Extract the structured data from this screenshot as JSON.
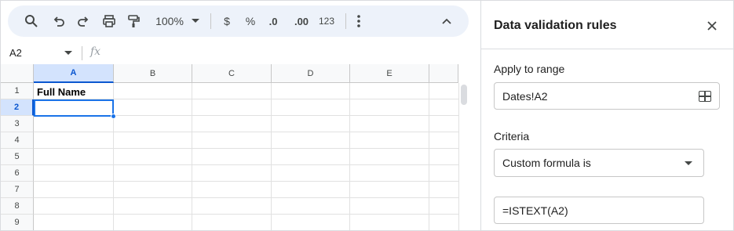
{
  "toolbar": {
    "zoom": "100%",
    "currency": "$",
    "percent": "%",
    "decrease_decimal": ".0",
    "increase_decimal": ".00",
    "number_format": "123"
  },
  "formula_bar": {
    "name_box": "A2",
    "fx": "fx",
    "value": ""
  },
  "grid": {
    "columns": [
      "A",
      "B",
      "C",
      "D",
      "E"
    ],
    "selected_column": "A",
    "rows": [
      "1",
      "2",
      "3",
      "4",
      "5",
      "6",
      "7",
      "8",
      "9"
    ],
    "selected_row": "2",
    "cells": {
      "A1": "Full Name"
    }
  },
  "panel": {
    "title": "Data validation rules",
    "apply_label": "Apply to range",
    "range_value": "Dates!A2",
    "criteria_label": "Criteria",
    "criteria_value": "Custom formula is",
    "formula_value": "=ISTEXT(A2)"
  },
  "icons": [
    "search-icon",
    "undo-icon",
    "redo-icon",
    "print-icon",
    "paint-format-icon",
    "chevron-down-icon",
    "more-vert-icon",
    "chevron-up-icon",
    "close-icon",
    "grid-select-icon"
  ],
  "colors": {
    "accent": "#1a73e8",
    "toolbar_bg": "#edf2fa",
    "header_selected": "#d3e3fd"
  }
}
